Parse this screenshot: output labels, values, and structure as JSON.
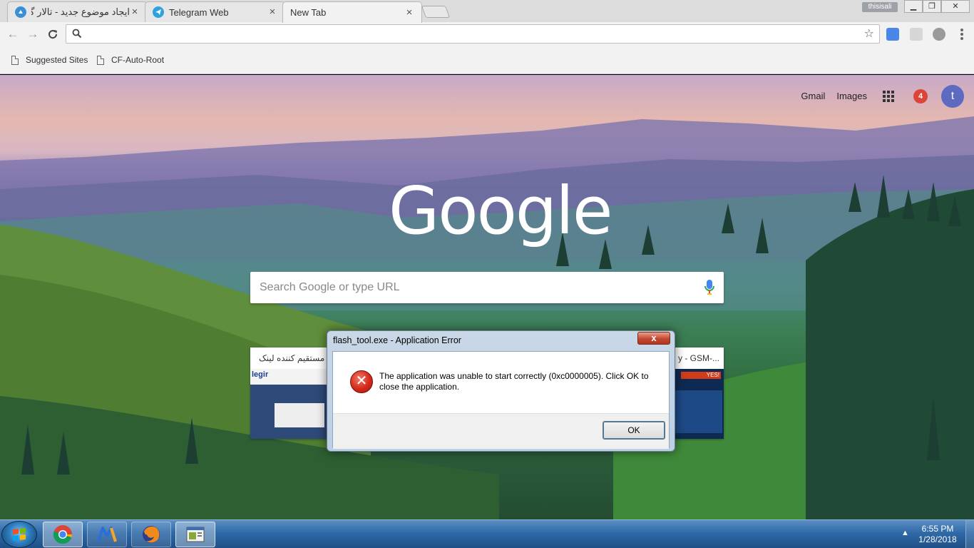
{
  "browser": {
    "tabs": [
      {
        "label": "ایجاد موضوع جدید - تالار گفتمان",
        "favicon": "forum-icon",
        "active": false
      },
      {
        "label": "Telegram Web",
        "favicon": "telegram-icon",
        "active": false
      },
      {
        "label": "New Tab",
        "favicon": "",
        "active": true
      }
    ],
    "profile_name": "thisisali",
    "address_bar_value": "",
    "bookmarks": [
      "Suggested Sites",
      "CF-Auto-Root"
    ]
  },
  "ntp": {
    "links": {
      "gmail": "Gmail",
      "images": "Images"
    },
    "notification_count": "4",
    "avatar_letter": "t",
    "logo_text": "Google",
    "search_placeholder": "Search Google or type URL",
    "tiles": [
      {
        "title": "مستقیم کننده لینک",
        "thumb_label": "legir"
      },
      {
        "title": "y - GSM-...",
        "thumb_label": "YES!"
      }
    ]
  },
  "dialog": {
    "title": "flash_tool.exe - Application Error",
    "message": "The application was unable to start correctly (0xc0000005). Click OK to close the application.",
    "ok_label": "OK",
    "close_label": "x",
    "icon": "error-icon"
  },
  "taskbar": {
    "pinned": [
      "chrome-icon",
      "mediatek-icon",
      "firefox-icon",
      "flash-tool-icon"
    ],
    "time": "6:55 PM",
    "date": "1/28/2018"
  },
  "colors": {
    "error_red": "#d42a1a",
    "avatar": "#5c6bc0",
    "badge": "#db4437",
    "taskbar": "#2f6aa8"
  }
}
